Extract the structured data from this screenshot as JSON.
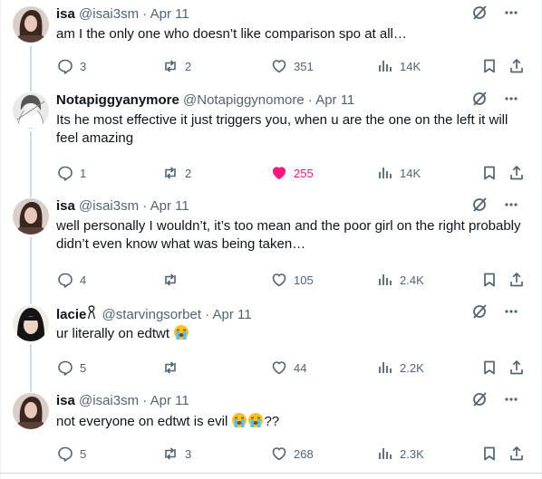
{
  "tweets": [
    {
      "name": "isa",
      "handle": "@isai3sm",
      "date": "Apr 11",
      "text": "am I the only one who doesn’t like comparison spo at all…",
      "replies": "3",
      "reposts": "2",
      "likes": "351",
      "views": "14K",
      "liked": false
    },
    {
      "name": "Notapiggyanymore",
      "handle": "@Notapiggynomore",
      "date": "Apr 11",
      "text": "Its he most effective it just triggers you, when u are the one on the left it will feel amazing",
      "replies": "1",
      "reposts": "2",
      "likes": "255",
      "views": "14K",
      "liked": true
    },
    {
      "name": "isa",
      "handle": "@isai3sm",
      "date": "Apr 11",
      "text": "well personally I wouldn’t, it’s too mean and the poor girl on the right probably didn’t even know what was being taken…",
      "replies": "4",
      "reposts": "",
      "likes": "105",
      "views": "2.4K",
      "liked": false
    },
    {
      "name": "lacie",
      "handle": "@starvingsorbet",
      "date": "Apr 11",
      "text": "ur literally on edtwt",
      "replies": "5",
      "reposts": "",
      "likes": "44",
      "views": "2.2K",
      "liked": false
    },
    {
      "name": "isa",
      "handle": "@isai3sm",
      "date": "Apr 11",
      "text": "not everyone on edtwt is evil",
      "text_suffix": "??",
      "replies": "5",
      "reposts": "3",
      "likes": "268",
      "views": "2.3K",
      "liked": false
    }
  ],
  "separator": "·",
  "icons": {
    "grok": "slashed-circle-icon",
    "more": "more-icon",
    "reply": "reply-icon",
    "repost": "repost-icon",
    "like": "heart-icon",
    "views": "bar-chart-icon",
    "bookmark": "bookmark-icon",
    "share": "share-icon",
    "badge": "ribbon-badge-icon",
    "emoji": "loudly-crying-face-icon"
  },
  "colors": {
    "text": "#0f1419",
    "muted": "#536471",
    "like_active": "#f91880",
    "line": "#cfd9de"
  }
}
